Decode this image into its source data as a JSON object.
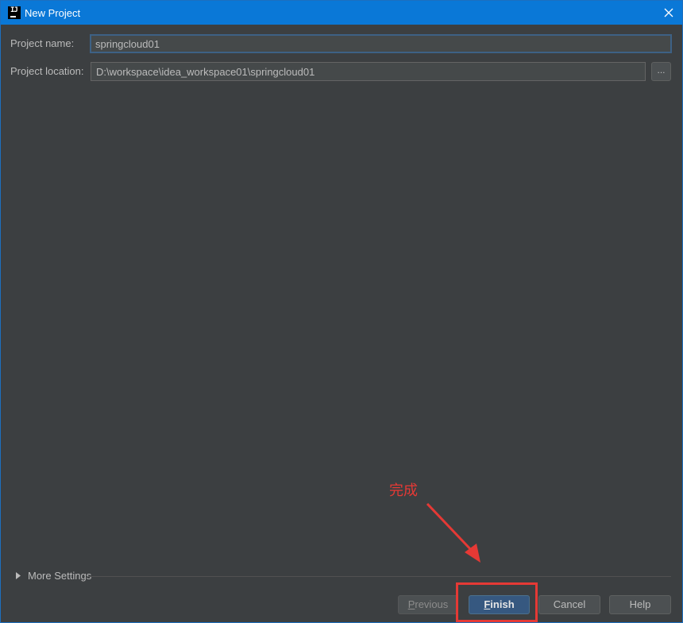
{
  "window": {
    "title": "New Project",
    "icon_label": "IJ"
  },
  "form": {
    "project_name_label": "Project name:",
    "project_name_value": "springcloud01",
    "project_location_label": "Project location:",
    "project_location_value": "D:\\workspace\\idea_workspace01\\springcloud01",
    "browse_label": "..."
  },
  "more_settings": {
    "label": "More Settings"
  },
  "buttons": {
    "previous": {
      "mnemonic": "P",
      "rest": "revious"
    },
    "finish": {
      "mnemonic": "F",
      "rest": "inish"
    },
    "cancel": "Cancel",
    "help": "Help"
  },
  "annotation": {
    "text": "完成",
    "color": "#e53935"
  },
  "colors": {
    "titlebar": "#0a78d7",
    "background": "#3c3f41",
    "primary_button": "#365880",
    "focus_border": "#3d6185"
  }
}
